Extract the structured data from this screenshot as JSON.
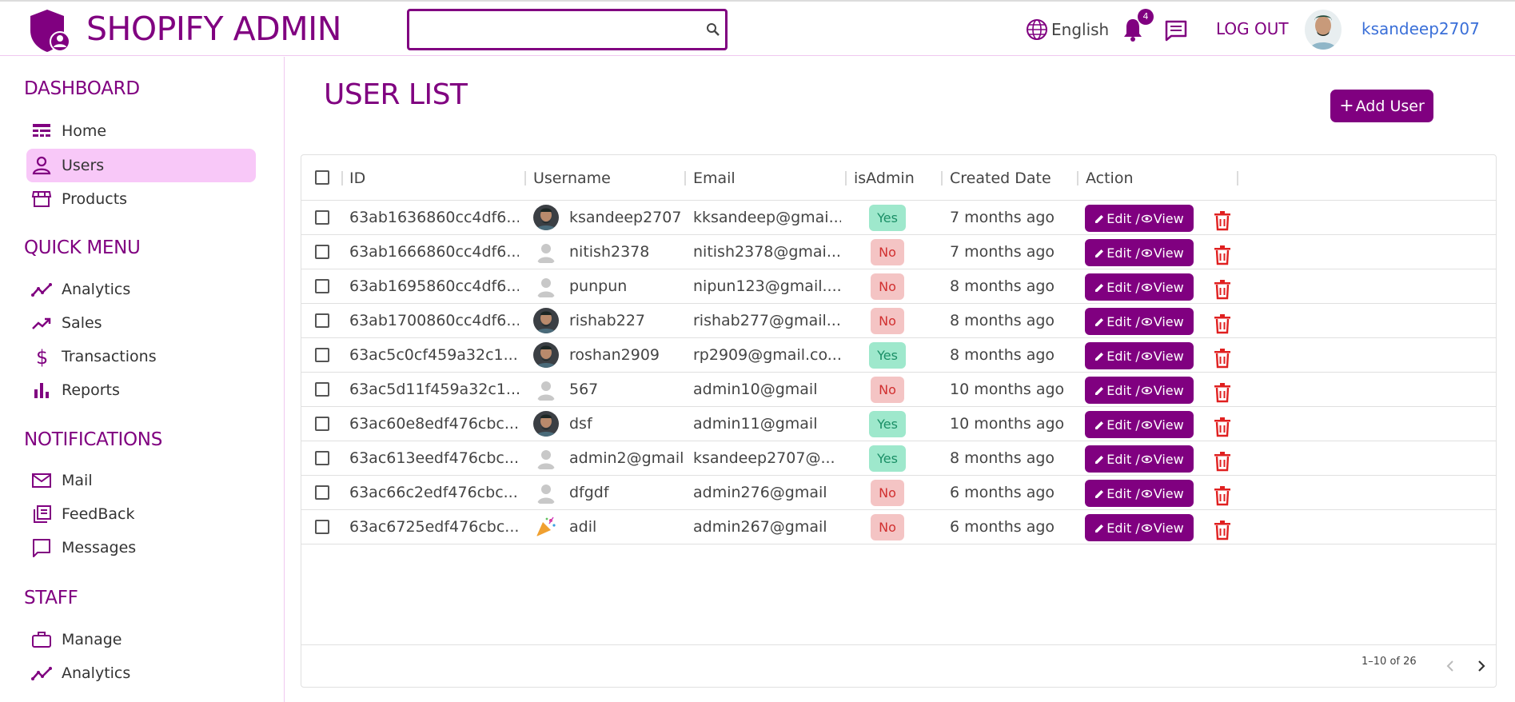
{
  "header": {
    "app_title": "SHOPIFY ADMIN",
    "search_placeholder": "",
    "language": "English",
    "notification_count": "4",
    "logout_label": "LOG OUT",
    "username": "ksandeep2707"
  },
  "sidebar": {
    "sections": [
      {
        "title": "DASHBOARD"
      },
      {
        "title": "QUICK MENU"
      },
      {
        "title": "NOTIFICATIONS"
      },
      {
        "title": "STAFF"
      }
    ],
    "items": [
      {
        "label": "Home",
        "icon": "dashboard-icon"
      },
      {
        "label": "Users",
        "icon": "person-icon",
        "active": true
      },
      {
        "label": "Products",
        "icon": "store-icon"
      },
      {
        "label": "Analytics",
        "icon": "timeline-icon"
      },
      {
        "label": "Sales",
        "icon": "trending-up-icon"
      },
      {
        "label": "Transactions",
        "icon": "dollar-icon"
      },
      {
        "label": "Reports",
        "icon": "bar-chart-icon"
      },
      {
        "label": "Mail",
        "icon": "mail-icon"
      },
      {
        "label": "FeedBack",
        "icon": "library-icon"
      },
      {
        "label": "Messages",
        "icon": "chat-icon"
      },
      {
        "label": "Manage",
        "icon": "briefcase-icon"
      },
      {
        "label": "Analytics",
        "icon": "timeline-icon"
      }
    ]
  },
  "main": {
    "title": "USER LIST",
    "add_button": "Add User",
    "columns": [
      "ID",
      "Username",
      "Email",
      "isAdmin",
      "Created Date",
      "Action"
    ],
    "edit_label": "Edit /",
    "view_label": "View",
    "rows": [
      {
        "id": "63ab1636860cc4df6...",
        "username": "ksandeep2707",
        "email": "kksandeep@gmai...",
        "isAdmin": "Yes",
        "created": "7 months ago",
        "avatar": "photo"
      },
      {
        "id": "63ab1666860cc4df6...",
        "username": "nitish2378",
        "email": "nitish2378@gmai...",
        "isAdmin": "No",
        "created": "7 months ago",
        "avatar": "default"
      },
      {
        "id": "63ab1695860cc4df6...",
        "username": "punpun",
        "email": "nipun123@gmail....",
        "isAdmin": "No",
        "created": "8 months ago",
        "avatar": "default"
      },
      {
        "id": "63ab1700860cc4df6...",
        "username": "rishab227",
        "email": "rishab277@gmail...",
        "isAdmin": "No",
        "created": "8 months ago",
        "avatar": "photo"
      },
      {
        "id": "63ac5c0cf459a32c1...",
        "username": "roshan2909",
        "email": "rp2909@gmail.co...",
        "isAdmin": "Yes",
        "created": "8 months ago",
        "avatar": "photo"
      },
      {
        "id": "63ac5d11f459a32c1...",
        "username": "567",
        "email": "admin10@gmail",
        "isAdmin": "No",
        "created": "10 months ago",
        "avatar": "default"
      },
      {
        "id": "63ac60e8edf476cbc...",
        "username": "dsf",
        "email": "admin11@gmail",
        "isAdmin": "Yes",
        "created": "10 months ago",
        "avatar": "photo"
      },
      {
        "id": "63ac613eedf476cbc...",
        "username": "admin2@gmail",
        "email": "ksandeep2707@...",
        "isAdmin": "Yes",
        "created": "8 months ago",
        "avatar": "default"
      },
      {
        "id": "63ac66c2edf476cbc...",
        "username": "dfgdf",
        "email": "admin276@gmail",
        "isAdmin": "No",
        "created": "6 months ago",
        "avatar": "default"
      },
      {
        "id": "63ac6725edf476cbc...",
        "username": "adil",
        "email": "admin267@gmail",
        "isAdmin": "No",
        "created": "6 months ago",
        "avatar": "party"
      }
    ],
    "pagination": "1–10 of 26"
  },
  "colors": {
    "accent": "#800080",
    "active_bg": "#f8c8f8",
    "yes_bg": "#9ee8cc",
    "no_bg": "#f4c4c4",
    "delete": "#e02020"
  }
}
